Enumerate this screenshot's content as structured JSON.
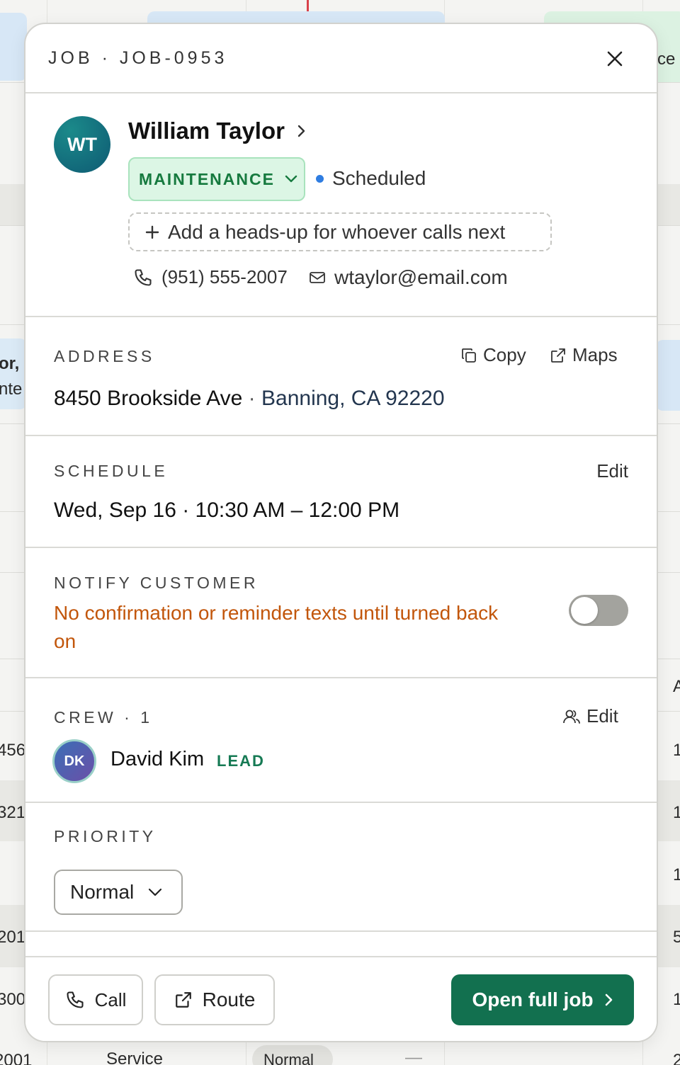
{
  "background": {
    "fragments": {
      "top_right": "ce",
      "left_1": "or,",
      "left_2": "nte",
      "left_3": "456",
      "left_4": "321",
      "left_5": "201",
      "left_6": "300",
      "left_7": "2001",
      "right_1": "A",
      "right_2": "1",
      "right_3": "1",
      "right_4": "1",
      "right_5": "5",
      "right_6": "1",
      "right_7": "2",
      "bottom_service": "Service",
      "bottom_normal": "Normal",
      "bottom_dash": "—"
    }
  },
  "modal": {
    "title": "JOB · JOB-0953",
    "customer": {
      "initials": "WT",
      "name": "William Taylor",
      "job_type": "MAINTENANCE",
      "status": "Scheduled",
      "headsup_label": "Add a heads-up for whoever calls next",
      "phone": "(951) 555-2007",
      "email": "wtaylor@email.com"
    },
    "address": {
      "label": "ADDRESS",
      "copy_label": "Copy",
      "maps_label": "Maps",
      "street": "8450 Brookside Ave",
      "separator": "·",
      "city": "Banning, CA 92220"
    },
    "schedule": {
      "label": "SCHEDULE",
      "edit_label": "Edit",
      "value": "Wed, Sep 16 · 10:30 AM – 12:00 PM"
    },
    "notify": {
      "label": "NOTIFY CUSTOMER",
      "message": "No confirmation or reminder texts until turned back on",
      "enabled": false
    },
    "crew": {
      "label": "CREW · 1",
      "edit_label": "Edit",
      "members": [
        {
          "initials": "DK",
          "name": "David Kim",
          "role": "LEAD"
        }
      ]
    },
    "priority": {
      "label": "PRIORITY",
      "value": "Normal"
    },
    "footer": {
      "call_label": "Call",
      "route_label": "Route",
      "open_label": "Open full job"
    }
  },
  "colors": {
    "brand_green": "#12704f",
    "pill_green": "#167a3f",
    "status_blue": "#2f7de1",
    "warning_orange": "#c2560b",
    "avatar_teal": "#0e5a73"
  }
}
